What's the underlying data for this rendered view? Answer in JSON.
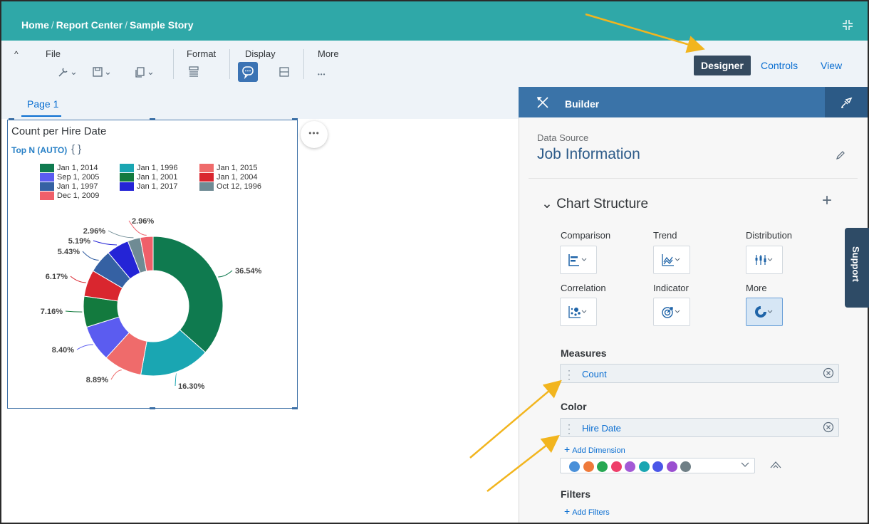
{
  "breadcrumb": [
    "Home",
    "Report Center",
    "Sample Story"
  ],
  "toolbar": {
    "file_label": "File",
    "format_label": "Format",
    "display_label": "Display",
    "more_label": "More",
    "more_icon": "•••"
  },
  "modes": [
    "Designer",
    "Controls",
    "View"
  ],
  "active_mode": "Designer",
  "page_tab": "Page 1",
  "widget": {
    "title": "Count per Hire Date",
    "topn": "Top N (AUTO)",
    "braces": "{ }",
    "more_bubble": "•••"
  },
  "chart_data": {
    "type": "pie",
    "donut": true,
    "title": "Count per Hire Date",
    "slices": [
      {
        "label": "Jan 1, 2014",
        "value": 36.54,
        "color": "#0f7a4f"
      },
      {
        "label": "Jan 1, 1996",
        "value": 16.3,
        "color": "#1aa6b2"
      },
      {
        "label": "Jan 1, 2015",
        "value": 8.89,
        "color": "#ef6b6b"
      },
      {
        "label": "Sep 1, 2005",
        "value": 8.4,
        "color": "#5b5cf0"
      },
      {
        "label": "Jan 1, 2001",
        "value": 7.16,
        "color": "#137a3e"
      },
      {
        "label": "Jan 1, 2004",
        "value": 6.17,
        "color": "#d9262f"
      },
      {
        "label": "Jan 1, 1997",
        "value": 5.43,
        "color": "#3561a3"
      },
      {
        "label": "Jan 1, 2017",
        "value": 5.19,
        "color": "#2424d6"
      },
      {
        "label": "Oct 12, 1996",
        "value": 2.96,
        "color": "#6f8b94"
      },
      {
        "label": "Dec 1, 2009",
        "value": 2.96,
        "color": "#ef5f6a"
      }
    ],
    "data_labels": [
      "36.54%",
      "16.30%",
      "8.89%",
      "8.40%",
      "7.16%",
      "6.17%",
      "5.43%",
      "5.19%",
      "2.96%",
      "2.96%"
    ],
    "legend_order": [
      "Jan 1, 2014",
      "Jan 1, 1996",
      "Jan 1, 2015",
      "Sep 1, 2005",
      "Jan 1, 2001",
      "Jan 1, 2004",
      "Jan 1, 1997",
      "Jan 1, 2017",
      "Oct 12, 1996",
      "Dec 1, 2009"
    ],
    "legend_placement": "top"
  },
  "builder": {
    "title": "Builder",
    "data_source_label": "Data Source",
    "data_source_value": "Job Information",
    "chart_structure": "Chart Structure",
    "chart_types": [
      "Comparison",
      "Trend",
      "Distribution",
      "Correlation",
      "Indicator",
      "More"
    ],
    "measures_title": "Measures",
    "measure": "Count",
    "color_title": "Color",
    "color_dimension": "Hire Date",
    "add_dimension": "Add Dimension",
    "palette": [
      "#4a90d9",
      "#ef7a3a",
      "#27a852",
      "#ee3f6a",
      "#a35ad6",
      "#1aa6b2",
      "#4a56e8",
      "#9a4fd0",
      "#6f7f86"
    ],
    "filters_title": "Filters",
    "add_filters": "Add Filters"
  },
  "support_label": "Support"
}
